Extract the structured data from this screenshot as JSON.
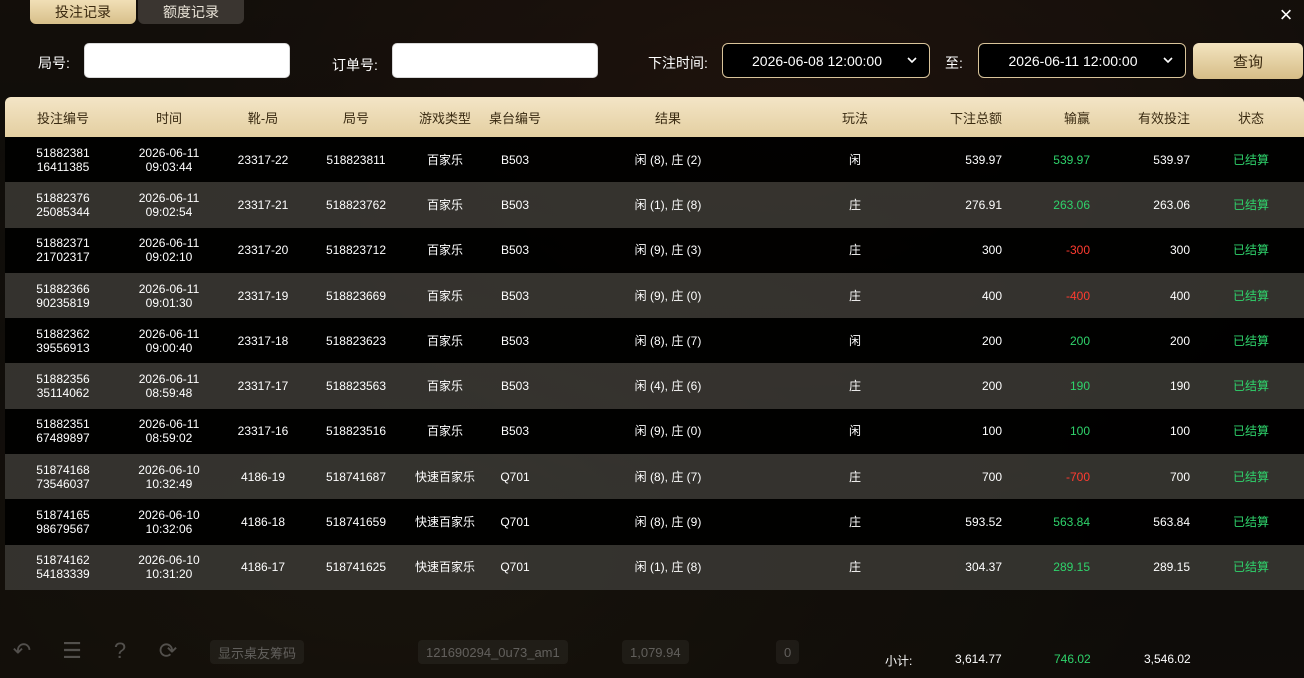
{
  "tabs": [
    {
      "label": "投注记录",
      "active": true
    },
    {
      "label": "额度记录",
      "active": false
    }
  ],
  "close_icon": "×",
  "search": {
    "round_label": "局号:",
    "round_value": "",
    "order_label": "订单号:",
    "order_value": "",
    "time_label": "下注时间:",
    "start": "2026-06-08 12:00:00",
    "to_label": "至:",
    "end": "2026-06-11 12:00:00",
    "query_label": "查询"
  },
  "columns": [
    "投注编号",
    "时间",
    "靴-局",
    "局号",
    "游戏类型",
    "桌台编号",
    "结果",
    "玩法",
    "下注总额",
    "输赢",
    "有效投注",
    "状态"
  ],
  "rows": [
    {
      "id1": "51882381",
      "id2": "16411385",
      "date": "2026-06-11",
      "time": "09:03:44",
      "shoe": "23317-22",
      "round": "518823811",
      "game": "百家乐",
      "table": "B503",
      "result": "闲 (8), 庄 (2)",
      "play": "闲",
      "bet": "539.97",
      "win": "539.97",
      "valid": "539.97",
      "status": "已结算"
    },
    {
      "id1": "51882376",
      "id2": "25085344",
      "date": "2026-06-11",
      "time": "09:02:54",
      "shoe": "23317-21",
      "round": "518823762",
      "game": "百家乐",
      "table": "B503",
      "result": "闲 (1), 庄 (8)",
      "play": "庄",
      "bet": "276.91",
      "win": "263.06",
      "valid": "263.06",
      "status": "已结算"
    },
    {
      "id1": "51882371",
      "id2": "21702317",
      "date": "2026-06-11",
      "time": "09:02:10",
      "shoe": "23317-20",
      "round": "518823712",
      "game": "百家乐",
      "table": "B503",
      "result": "闲 (9), 庄 (3)",
      "play": "庄",
      "bet": "300",
      "win": "-300",
      "valid": "300",
      "status": "已结算"
    },
    {
      "id1": "51882366",
      "id2": "90235819",
      "date": "2026-06-11",
      "time": "09:01:30",
      "shoe": "23317-19",
      "round": "518823669",
      "game": "百家乐",
      "table": "B503",
      "result": "闲 (9), 庄 (0)",
      "play": "庄",
      "bet": "400",
      "win": "-400",
      "valid": "400",
      "status": "已结算"
    },
    {
      "id1": "51882362",
      "id2": "39556913",
      "date": "2026-06-11",
      "time": "09:00:40",
      "shoe": "23317-18",
      "round": "518823623",
      "game": "百家乐",
      "table": "B503",
      "result": "闲 (8), 庄 (7)",
      "play": "闲",
      "bet": "200",
      "win": "200",
      "valid": "200",
      "status": "已结算"
    },
    {
      "id1": "51882356",
      "id2": "35114062",
      "date": "2026-06-11",
      "time": "08:59:48",
      "shoe": "23317-17",
      "round": "518823563",
      "game": "百家乐",
      "table": "B503",
      "result": "闲 (4), 庄 (6)",
      "play": "庄",
      "bet": "200",
      "win": "190",
      "valid": "190",
      "status": "已结算"
    },
    {
      "id1": "51882351",
      "id2": "67489897",
      "date": "2026-06-11",
      "time": "08:59:02",
      "shoe": "23317-16",
      "round": "518823516",
      "game": "百家乐",
      "table": "B503",
      "result": "闲 (9), 庄 (0)",
      "play": "闲",
      "bet": "100",
      "win": "100",
      "valid": "100",
      "status": "已结算"
    },
    {
      "id1": "51874168",
      "id2": "73546037",
      "date": "2026-06-10",
      "time": "10:32:49",
      "shoe": "4186-19",
      "round": "518741687",
      "game": "快速百家乐",
      "table": "Q701",
      "result": "闲 (8), 庄 (7)",
      "play": "庄",
      "bet": "700",
      "win": "-700",
      "valid": "700",
      "status": "已结算"
    },
    {
      "id1": "51874165",
      "id2": "98679567",
      "date": "2026-06-10",
      "time": "10:32:06",
      "shoe": "4186-18",
      "round": "518741659",
      "game": "快速百家乐",
      "table": "Q701",
      "result": "闲 (8), 庄 (9)",
      "play": "庄",
      "bet": "593.52",
      "win": "563.84",
      "valid": "563.84",
      "status": "已结算"
    },
    {
      "id1": "51874162",
      "id2": "54183339",
      "date": "2026-06-10",
      "time": "10:31:20",
      "shoe": "4186-17",
      "round": "518741625",
      "game": "快速百家乐",
      "table": "Q701",
      "result": "闲 (1), 庄 (8)",
      "play": "庄",
      "bet": "304.37",
      "win": "289.15",
      "valid": "289.15",
      "status": "已结算"
    }
  ],
  "summary": {
    "label": "小计:",
    "total_bet": "3,614.77",
    "total_win": "746.02",
    "total_valid": "3,546.02"
  },
  "bottom_bar": {
    "username": "121690294_0u73_am1",
    "balance": "1,079.94",
    "show_chips": "显示桌友筹码",
    "count": "0"
  },
  "colors": {
    "positive": "#2fd36b",
    "negative": "#ff3b30",
    "accent": "#e4cfa1"
  }
}
